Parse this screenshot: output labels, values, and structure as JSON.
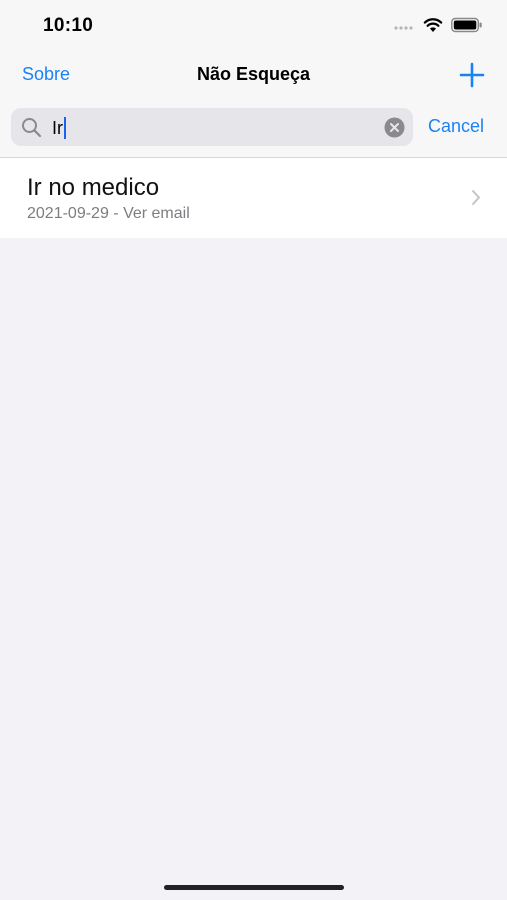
{
  "status_bar": {
    "time": "10:10"
  },
  "nav": {
    "left_label": "Sobre",
    "title": "Não Esqueça",
    "add_icon": "plus-icon"
  },
  "search": {
    "value": "Ir",
    "cancel_label": "Cancel"
  },
  "results": [
    {
      "title": "Ir no medico",
      "subtitle": "2021-09-29 - Ver email"
    }
  ],
  "colors": {
    "accent": "#1a82f5",
    "background": "#f2f2f7",
    "caret": "#1a62f0"
  }
}
